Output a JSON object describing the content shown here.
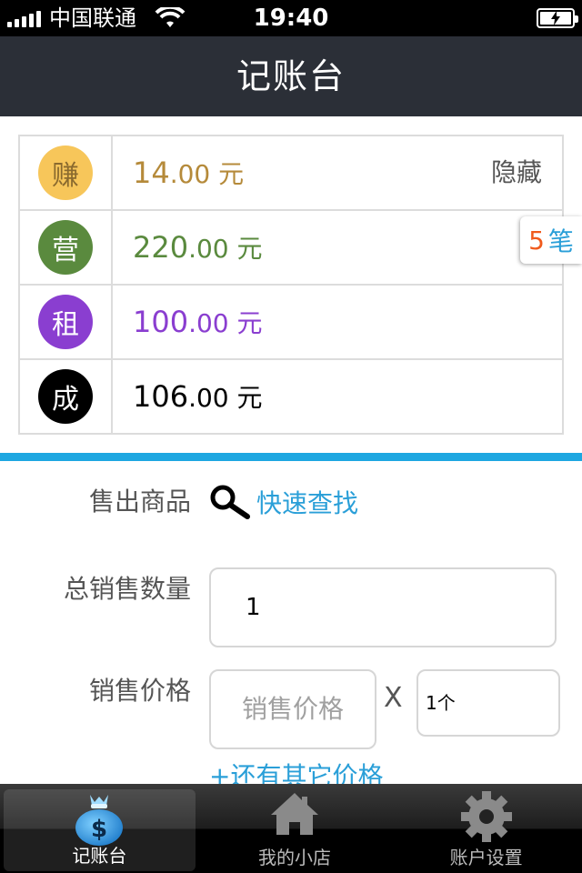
{
  "status_bar": {
    "carrier": "中国联通",
    "time": "19:40"
  },
  "nav": {
    "title": "记账台"
  },
  "summary": {
    "hide_label": "隐藏",
    "rows": [
      {
        "badge": "赚",
        "integer": "14",
        "decimal": ".00",
        "unit": " 元",
        "badge_color": "#f7c65a",
        "badge_text_color": "#8a6a2e",
        "amount_color": "#b58a3a"
      },
      {
        "badge": "营",
        "integer": "220",
        "decimal": ".00",
        "unit": " 元",
        "badge_color": "#5a8a3e",
        "badge_text_color": "#ffffff",
        "amount_color": "#5a8a3e"
      },
      {
        "badge": "租",
        "integer": "100",
        "decimal": ".00",
        "unit": " 元",
        "badge_color": "#8a3ed0",
        "badge_text_color": "#ffffff",
        "amount_color": "#8a3ed0"
      },
      {
        "badge": "成",
        "integer": "106",
        "decimal": ".00",
        "unit": " 元",
        "badge_color": "#000000",
        "badge_text_color": "#ffffff",
        "amount_color": "#000000"
      }
    ]
  },
  "count_tab": {
    "count": "5",
    "unit": "笔"
  },
  "accent_color": "#1ea7e1",
  "form": {
    "goods_label": "售出商品",
    "quick_find": "快速查找",
    "quantity_label": "总销售数量",
    "quantity_value": "1",
    "price_label": "销售价格",
    "price_placeholder": "销售价格",
    "times": "X",
    "unit_value": "1个",
    "more_prices": "+还有其它价格"
  },
  "tabs": [
    {
      "label": "记账台",
      "icon": "money-bag-icon",
      "active": true
    },
    {
      "label": "我的小店",
      "icon": "home-icon",
      "active": false
    },
    {
      "label": "账户设置",
      "icon": "gear-icon",
      "active": false
    }
  ]
}
